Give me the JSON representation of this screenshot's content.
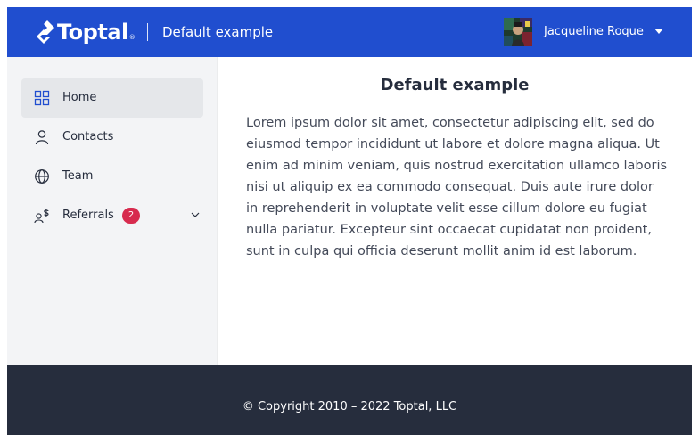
{
  "header": {
    "brand": "Toptal",
    "brand_mark": "®",
    "page_title": "Default example",
    "user_name": "Jacqueline Roque",
    "background": "#204ecf"
  },
  "sidebar": {
    "items": [
      {
        "label": "Home",
        "icon": "grid-icon",
        "active": true
      },
      {
        "label": "Contacts",
        "icon": "user-icon",
        "active": false
      },
      {
        "label": "Team",
        "icon": "globe-icon",
        "active": false
      },
      {
        "label": "Referrals",
        "icon": "referral-dollar-icon",
        "badge": "2",
        "expandable": true,
        "active": false
      }
    ]
  },
  "main": {
    "title": "Default example",
    "body": "Lorem ipsum dolor sit amet, consectetur adipiscing elit, sed do eiusmod tempor incididunt ut labore et dolore magna aliqua. Ut enim ad minim veniam, quis nostrud exercitation ullamco laboris nisi ut aliquip ex ea commodo consequat. Duis aute irure dolor in reprehenderit in voluptate velit esse cillum dolore eu fugiat nulla pariatur. Excepteur sint occaecat cupidatat non proident, sunt in culpa qui officia deserunt mollit anim id est laborum."
  },
  "footer": {
    "copyright": "© Copyright 2010 – 2022 Toptal, LLC",
    "background": "#262d3d"
  },
  "colors": {
    "badge": "#d72b4e",
    "sidebar_bg": "#f3f4f6",
    "active_item_bg": "#e5e7ea"
  }
}
